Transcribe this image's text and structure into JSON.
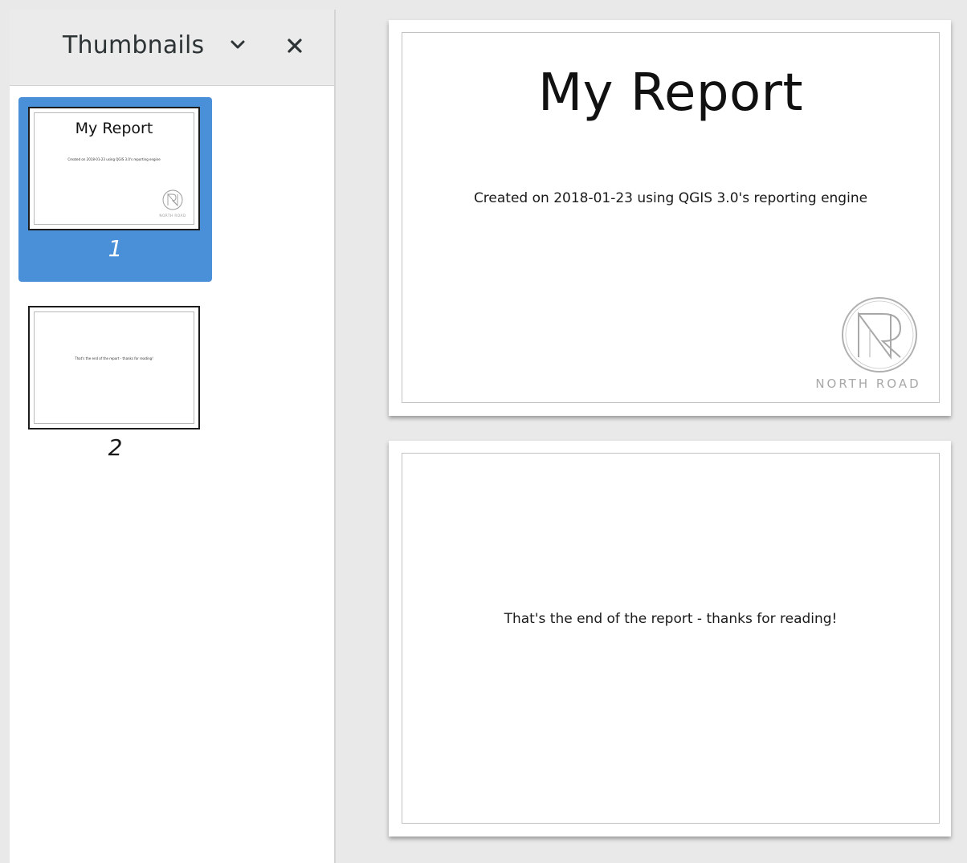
{
  "sidebar": {
    "header": {
      "title": "Thumbnails",
      "dropdown_icon": "chevron-down-icon",
      "close_icon": "close-icon"
    },
    "thumbnails": [
      {
        "number": "1",
        "selected": true,
        "title": "My Report",
        "subtitle": "Created on 2018-01-23 using QGIS 3.0's reporting engine",
        "logo_text": "NORTH ROAD"
      },
      {
        "number": "2",
        "selected": false,
        "text": "That's the end of the report - thanks for reading!"
      }
    ]
  },
  "document": {
    "pages": [
      {
        "title": "My Report",
        "subtitle": "Created on 2018-01-23 using QGIS 3.0's reporting engine",
        "logo_text": "NORTH ROAD"
      },
      {
        "text": "That's the end of the report - thanks for reading!"
      }
    ]
  },
  "colors": {
    "selection": "#4a90d9",
    "header_background": "#ebebeb",
    "canvas_background": "#e9e9e9",
    "logo": "#a8a8a8"
  }
}
